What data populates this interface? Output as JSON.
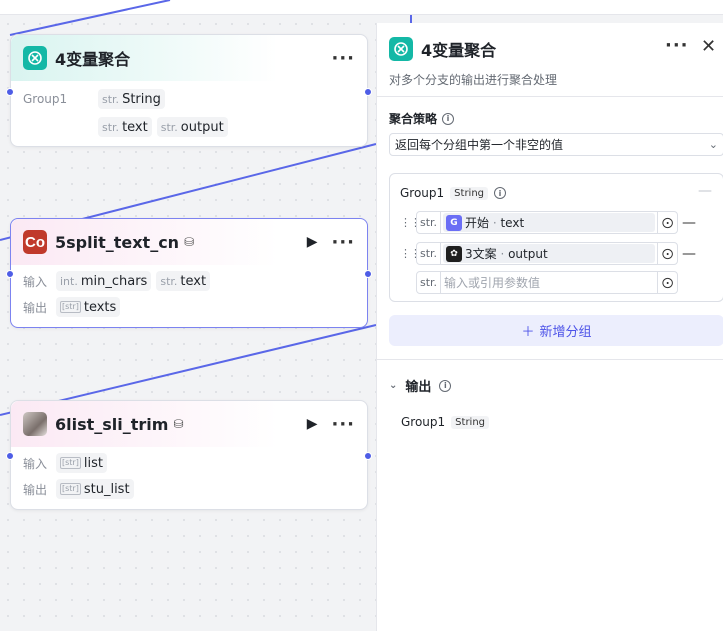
{
  "canvas_nodes": [
    {
      "title": "4变量聚合",
      "group_label": "Group1",
      "params": [
        {
          "type": "str.",
          "name": "String"
        },
        {
          "type": "str.",
          "name": "text"
        },
        {
          "type": "str.",
          "name": "output"
        }
      ]
    },
    {
      "avatar": "Co",
      "title": "5split_text_cn",
      "input_label": "输入",
      "inputs": [
        {
          "type": "int.",
          "name": "min_chars"
        },
        {
          "type": "str.",
          "name": "text"
        }
      ],
      "output_label": "输出",
      "outputs": [
        {
          "type": "[str]",
          "name": "texts"
        }
      ]
    },
    {
      "title": "6list_sli_trim",
      "input_label": "输入",
      "inputs": [
        {
          "type": "[str]",
          "name": "list"
        }
      ],
      "output_label": "输出",
      "outputs": [
        {
          "type": "[str]",
          "name": "stu_list"
        }
      ]
    }
  ],
  "panel": {
    "title": "4变量聚合",
    "subtitle": "对多个分支的输出进行聚合处理",
    "strategy_label": "聚合策略",
    "strategy_value": "返回每个分组中第一个非空的值",
    "group": {
      "name": "Group1",
      "type": "String",
      "vars": [
        {
          "type": "str.",
          "source": "开始",
          "field": "text",
          "icon": "start-node-icon"
        },
        {
          "type": "str.",
          "source": "3文案",
          "field": "output",
          "icon": "llm-node-icon"
        }
      ],
      "empty_var": {
        "type": "str.",
        "placeholder": "输入或引用参数值"
      }
    },
    "add_group_label": "新增分组",
    "output_label": "输出",
    "output_item": {
      "name": "Group1",
      "type": "String"
    }
  },
  "colors": {
    "accent": "#4d53e8",
    "edge": "#4e5de6",
    "teal_icon": "#14b8a6",
    "red_icon": "#c0392b"
  }
}
